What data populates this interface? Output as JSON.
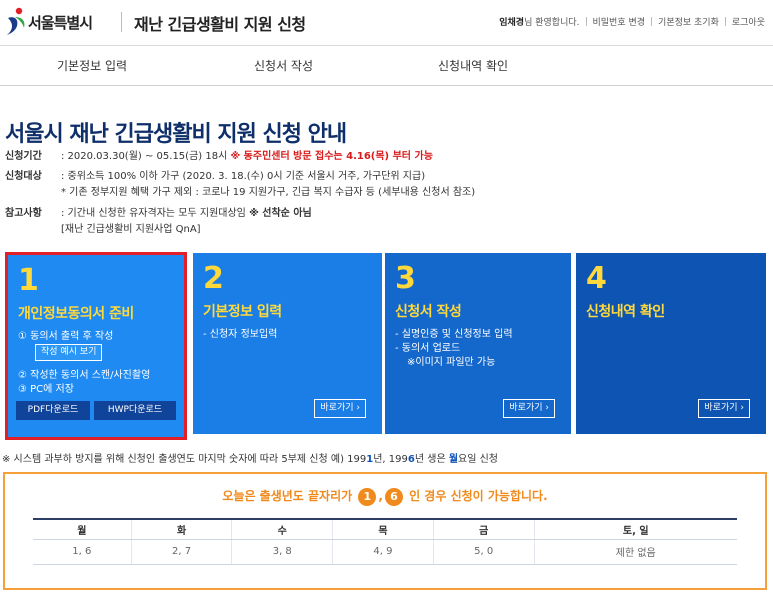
{
  "header": {
    "logo_text": "서울특별시",
    "title": "재난 긴급생활비 지원 신청",
    "user_name": "임채경",
    "welcome_suffix": "님 환영합니다.",
    "links": [
      "비밀번호 변경",
      "기본정보 초기화",
      "로그아웃"
    ]
  },
  "nav": {
    "items": [
      "기본정보 입력",
      "신청서 작성",
      "신청내역 확인"
    ]
  },
  "main": {
    "title": "서울시 재난 긴급생활비 지원 신청 안내",
    "period_label": "신청기간",
    "period_value": ": 2020.03.30(월) ~ 05.15(금) 18시",
    "period_notice": "※ 동주민센터 방문 접수는 4.16(목) 부터 가능",
    "target_label": "신청대상",
    "target_value": ": 중위소득 100% 이하 가구 (2020. 3. 18.(수) 0시 기준 서울시 거주, 가구단위 지급)",
    "target_note": "* 기존 정부지원 혜택 가구 제외 : 코로나 19 지원가구, 긴급 복지 수급자 등 (세부내용 신청서 참조)",
    "ref_label": "참고사항",
    "ref_value": ": 기간내 신청한 유자격자는 모두 지원대상임",
    "ref_bold": "※ 선착순 아님",
    "ref_link": "[재난 긴급생활비 지원사업 QnA]"
  },
  "cards": [
    {
      "num": "1",
      "title": "개인정보동의서 준비",
      "line1": "① 동의서 출력 후 작성",
      "sample_btn": "작성 예시 보기",
      "line2": "② 작성한 동의서 스캔/사진촬영",
      "line3": "③ PC에 저장",
      "pdf_btn": "PDF다운로드",
      "hwp_btn": "HWP다운로드"
    },
    {
      "num": "2",
      "title": "기본정보 입력",
      "line1": "- 신청자 정보입력",
      "go_btn": "바로가기 ›"
    },
    {
      "num": "3",
      "title": "신청서 작성",
      "line1": "- 실명인증 및 신청정보 입력",
      "line2": "- 동의서 업로드",
      "line3": "※이미지 파일만 가능",
      "go_btn": "바로가기 ›"
    },
    {
      "num": "4",
      "title": "신청내역 확인",
      "go_btn": "바로가기 ›"
    }
  ],
  "note": {
    "text": "※ 시스템 과부하 방지를 위해 신청인 출생연도 마지막 숫자에 따라 5부제 신청   예) 199",
    "b1": "1",
    "t2": "년, 199",
    "b2": "6",
    "t3": "년 생은 ",
    "b3": "월",
    "t4": "요일 신청"
  },
  "schedule": {
    "title_pre": "오늘은 출생년도 끝자리가",
    "digit1": "1",
    "comma": ",",
    "digit2": "6",
    "title_post": "인 경우 신청이 가능합니다.",
    "headers": [
      "월",
      "화",
      "수",
      "목",
      "금",
      "토, 일"
    ],
    "values": [
      "1, 6",
      "2, 7",
      "3, 8",
      "4, 9",
      "5, 0",
      "제한 없음"
    ]
  },
  "colors": {
    "accent_yellow": "#ffd93b",
    "navy_title": "#0f2f6a",
    "notice_red": "#d81b1b",
    "orange": "#f08a1c",
    "highlight_border": "#e21f26"
  }
}
